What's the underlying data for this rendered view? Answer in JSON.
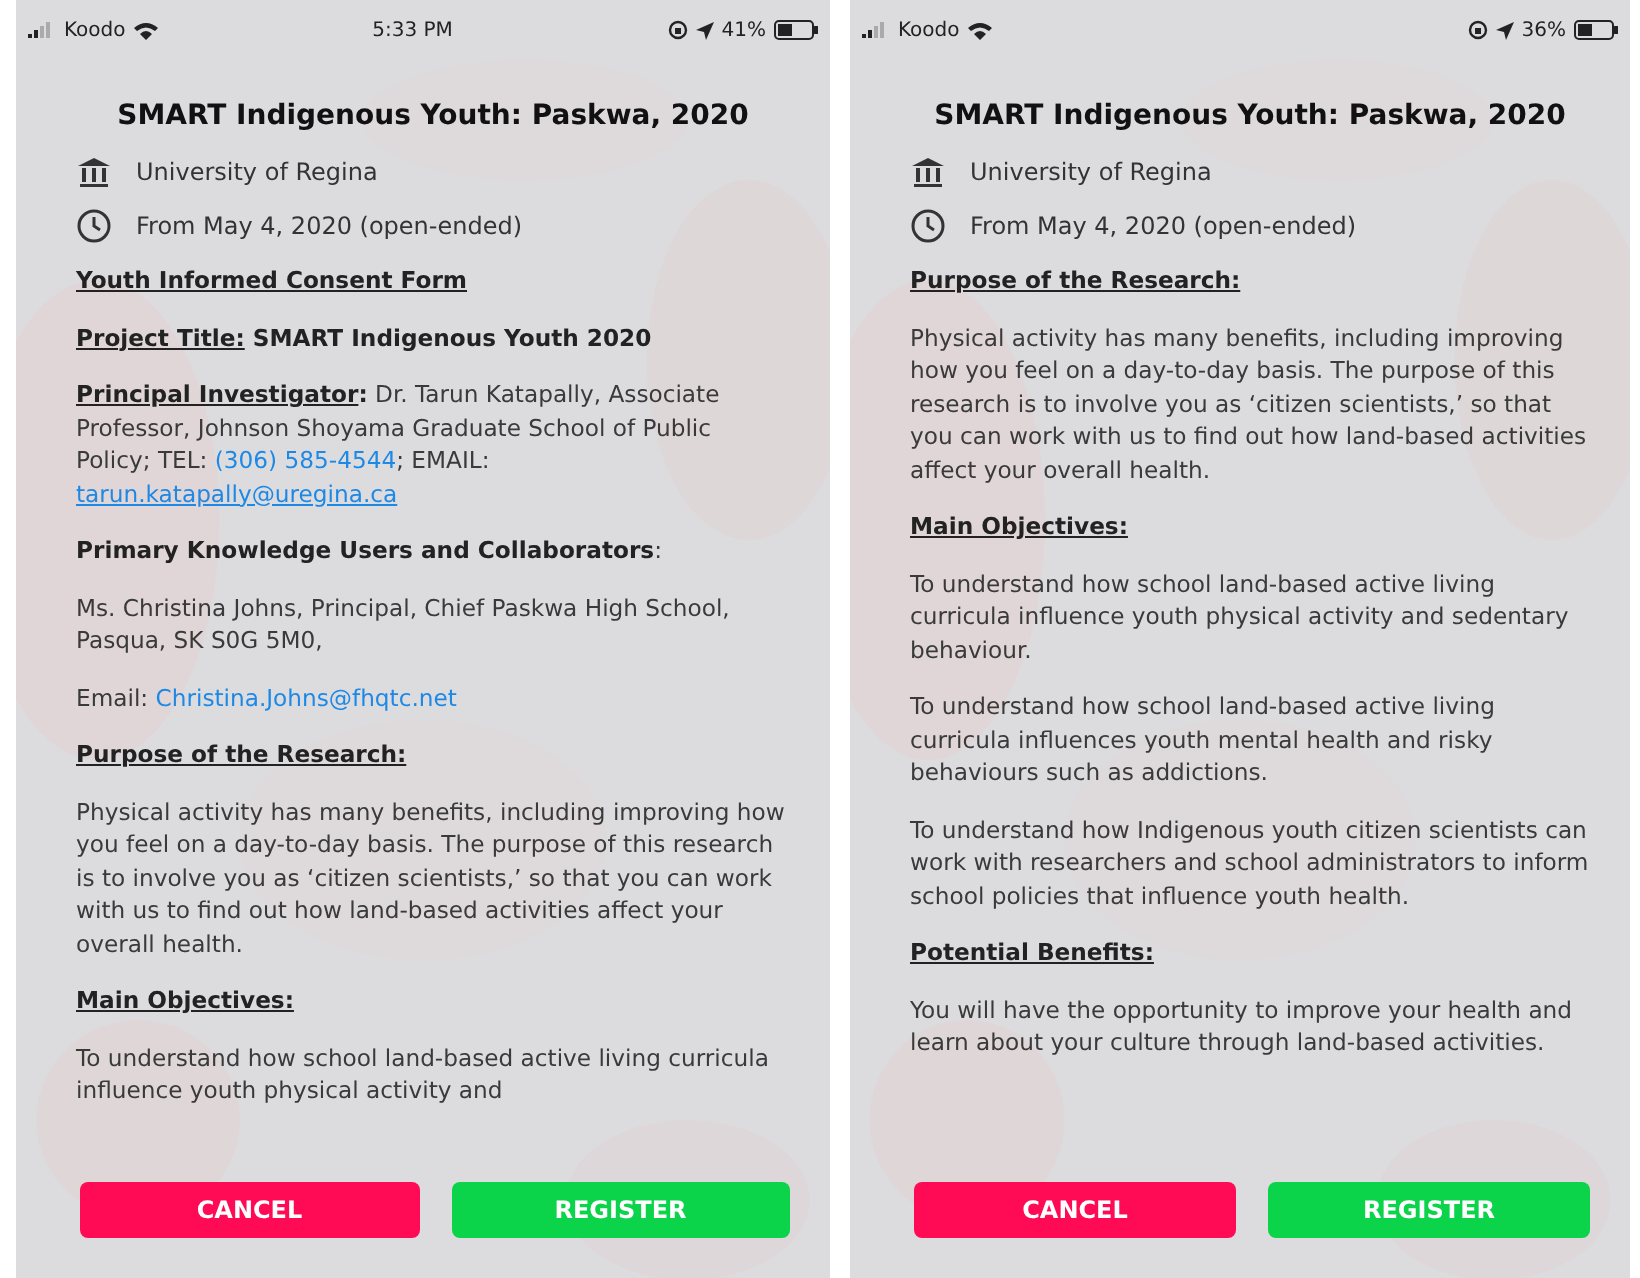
{
  "screens": [
    {
      "status_bar": {
        "carrier": "Koodo",
        "time": "5:33 PM",
        "battery": "41%"
      },
      "title": "SMART Indigenous Youth: Paskwa, 2020",
      "institution": "University of Regina",
      "dates": "From May 4, 2020 (open-ended)",
      "blocks": [
        {
          "kind": "heading",
          "text": "Youth Informed Consent Form"
        },
        {
          "kind": "paragraph",
          "runs": [
            {
              "kind": "label",
              "text": "Project Title:"
            },
            {
              "kind": "bold",
              "text": " SMART Indigenous Youth 2020"
            }
          ]
        },
        {
          "kind": "paragraph",
          "runs": [
            {
              "kind": "label",
              "text": "Principal Investigator"
            },
            {
              "kind": "bold",
              "text": ":"
            },
            {
              "kind": "text",
              "text": " Dr. Tarun Katapally, Associate Professor, Johnson Shoyama Graduate School of Public Policy; TEL: "
            },
            {
              "kind": "phone_link",
              "text": "(306) 585-4544"
            },
            {
              "kind": "text",
              "text": "; EMAIL: "
            },
            {
              "kind": "email_link",
              "text": "tarun.katapally@uregina.ca"
            }
          ]
        },
        {
          "kind": "paragraph",
          "runs": [
            {
              "kind": "bold",
              "text": "Primary Knowledge Users and Collaborators"
            },
            {
              "kind": "text",
              "text": ":"
            }
          ]
        },
        {
          "kind": "paragraph",
          "runs": [
            {
              "kind": "text",
              "text": "Ms. Christina Johns, Principal, Chief Paskwa High School, Pasqua, SK S0G 5M0,"
            }
          ]
        },
        {
          "kind": "paragraph",
          "runs": [
            {
              "kind": "text",
              "text": "Email: "
            },
            {
              "kind": "plain_link",
              "text": "Christina.Johns@fhqtc.net"
            }
          ]
        },
        {
          "kind": "heading",
          "text": "Purpose of the Research:"
        },
        {
          "kind": "paragraph",
          "runs": [
            {
              "kind": "text",
              "text": "Physical activity has many benefits, including improving how you feel on a day-to-day basis. The purpose of this research is to involve you as ‘citizen scientists,’ so that you can work with us to find out how land-based activities affect your overall health."
            }
          ]
        },
        {
          "kind": "heading",
          "text": "Main Objectives:"
        },
        {
          "kind": "paragraph",
          "runs": [
            {
              "kind": "text",
              "text": "To understand how school land-based active living curricula influence youth physical activity and"
            }
          ]
        }
      ],
      "buttons": [
        {
          "kind": "cancel",
          "label": "CANCEL"
        },
        {
          "kind": "register",
          "label": "REGISTER"
        }
      ]
    },
    {
      "status_bar": {
        "carrier": "Koodo",
        "battery": "36%"
      },
      "title": "SMART Indigenous Youth: Paskwa, 2020",
      "institution": "University of Regina",
      "dates": "From May 4, 2020 (open-ended)",
      "blocks": [
        {
          "kind": "heading",
          "text": "Purpose of the Research:"
        },
        {
          "kind": "paragraph",
          "runs": [
            {
              "kind": "text",
              "text": "Physical activity has many benefits, including improving how you feel on a day-to-day basis. The purpose of this research is to involve you as ‘citizen scientists,’ so that you can work with us to find out how land-based activities affect your overall health."
            }
          ]
        },
        {
          "kind": "heading",
          "text": "Main Objectives:"
        },
        {
          "kind": "paragraph",
          "runs": [
            {
              "kind": "text",
              "text": "To understand how school land-based active living curricula influence youth physical activity and sedentary behaviour."
            }
          ]
        },
        {
          "kind": "paragraph",
          "runs": [
            {
              "kind": "text",
              "text": "To understand how school land-based active living curricula influences youth mental health and risky behaviours such as addictions."
            }
          ]
        },
        {
          "kind": "paragraph",
          "runs": [
            {
              "kind": "text",
              "text": "To understand how Indigenous youth citizen scientists can work with researchers and school administrators to inform school policies that influence youth health."
            }
          ]
        },
        {
          "kind": "heading",
          "text": "Potential Benefits:"
        },
        {
          "kind": "paragraph",
          "runs": [
            {
              "kind": "text",
              "text": "You will have the opportunity to improve your health and learn about your culture through land-based activities."
            }
          ]
        }
      ],
      "buttons": [
        {
          "kind": "cancel",
          "label": "CANCEL"
        },
        {
          "kind": "register",
          "label": "REGISTER"
        }
      ]
    }
  ]
}
